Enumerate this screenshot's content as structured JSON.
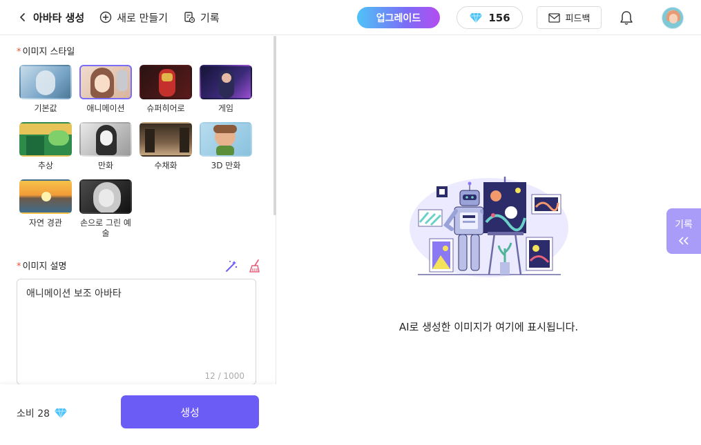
{
  "header": {
    "back_title": "아바타 생성",
    "new_create": "새로 만들기",
    "history": "기록",
    "upgrade": "업그레이드",
    "credits": "156",
    "feedback": "피드백"
  },
  "style_section": {
    "label": "이미지 스타일",
    "required_mark": "*",
    "selected": "애니메이션",
    "items": [
      {
        "label": "기본값",
        "colors": [
          "#7aa6c8",
          "#c8dbe8"
        ]
      },
      {
        "label": "애니메이션",
        "colors": [
          "#e7c7b3",
          "#8b5a45"
        ]
      },
      {
        "label": "슈퍼히어로",
        "colors": [
          "#5a1b1b",
          "#d0302c"
        ]
      },
      {
        "label": "게임",
        "colors": [
          "#1c1b46",
          "#9b4fd2"
        ]
      },
      {
        "label": "추상",
        "colors": [
          "#2f8b4a",
          "#e6c45a"
        ]
      },
      {
        "label": "만화",
        "colors": [
          "#3a3a3a",
          "#d5d5d5"
        ]
      },
      {
        "label": "수채화",
        "colors": [
          "#5a4632",
          "#c7a882"
        ]
      },
      {
        "label": "3D 만화",
        "colors": [
          "#8ac2de",
          "#e7b38f"
        ]
      },
      {
        "label": "자연 경관",
        "colors": [
          "#f29c38",
          "#3f6d8c"
        ]
      },
      {
        "label": "손으로 그린 예술",
        "colors": [
          "#1e1e1e",
          "#9a9a9a"
        ]
      }
    ]
  },
  "description_section": {
    "label": "이미지 설명",
    "required_mark": "*",
    "value": "애니메이션 보조 아바타",
    "count": "12 / 1000"
  },
  "footer": {
    "cost": "소비 28",
    "generate": "생성"
  },
  "preview": {
    "placeholder": "AI로 생성한 이미지가 여기에 표시됩니다.",
    "history_tab": "기록"
  },
  "colors": {
    "accent": "#6c5cf6",
    "accent_light": "#a99cf9",
    "required": "#f0523c"
  }
}
